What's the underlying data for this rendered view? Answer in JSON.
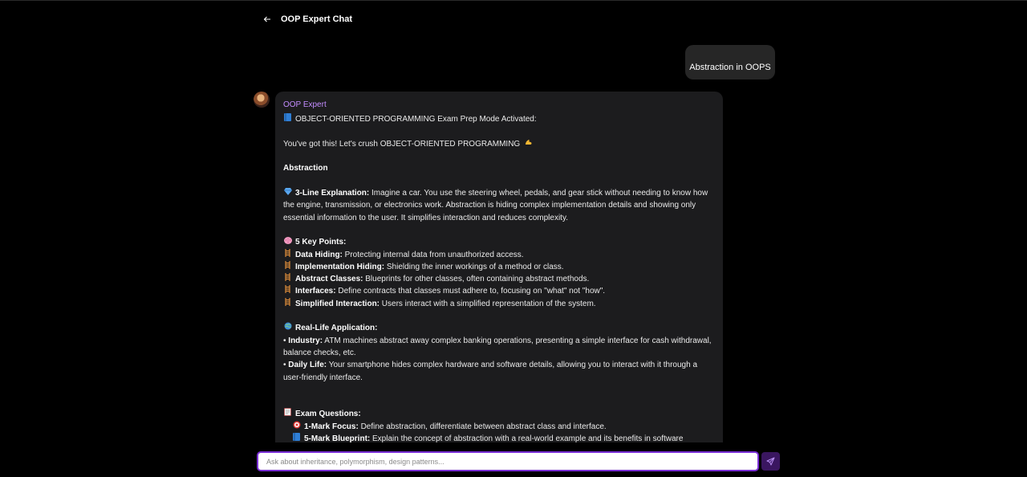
{
  "header": {
    "title": "OOP Expert Chat"
  },
  "user_message": "Abstraction in OOPS",
  "bot": {
    "sender": "OOP Expert",
    "intro": "OBJECT-ORIENTED PROGRAMMING Exam Prep Mode Activated:",
    "encourage": "You've got this! Let's crush OBJECT-ORIENTED PROGRAMMING",
    "heading": "Abstraction",
    "explanation": {
      "label": "3-Line Explanation:",
      "text": " Imagine a car. You use the steering wheel, pedals, and gear stick without needing to know how the engine, transmission, or electronics work. Abstraction is hiding complex implementation details and showing only essential information to the user.  It simplifies interaction and reduces complexity."
    },
    "key_points_label": "5 Key Points:",
    "key_points": [
      {
        "label": "Data Hiding:",
        "text": " Protecting internal data from unauthorized access."
      },
      {
        "label": "Implementation Hiding:",
        "text": "  Shielding the inner workings of a method or class."
      },
      {
        "label": "Abstract Classes:",
        "text": " Blueprints for other classes, often containing abstract methods."
      },
      {
        "label": "Interfaces:",
        "text": " Define contracts that classes must adhere to, focusing on \"what\" not \"how\"."
      },
      {
        "label": "Simplified Interaction:",
        "text": "  Users interact with a simplified representation of the system."
      }
    ],
    "real_life_label": "Real-Life Application:",
    "industry": {
      "label": "Industry:",
      "text": " ATM machines abstract away complex banking operations, presenting a simple interface for cash withdrawal, balance checks, etc."
    },
    "daily": {
      "label": "Daily Life:",
      "text": " Your smartphone hides complex hardware and software details, allowing you to interact with it through a user-friendly interface."
    },
    "exam_label": "Exam Questions:",
    "exam": [
      {
        "label": "1-Mark Focus:",
        "text": " Define abstraction, differentiate between abstract class and interface."
      },
      {
        "label": "5-Mark Blueprint:",
        "text": " Explain the concept of abstraction with a real-world example and its benefits in software"
      }
    ],
    "bullet": "•"
  },
  "input": {
    "placeholder": "Ask about inheritance, polymorphism, design patterns..."
  },
  "icons": {
    "back": "arrow-left-icon",
    "avatar": "avatar",
    "book": "book-icon",
    "flex": "flexed-biceps-icon",
    "gem": "gem-icon",
    "brain": "brain-icon",
    "point": "ladder-icon",
    "globe": "globe-icon",
    "memo": "memo-icon",
    "target": "target-icon",
    "send": "send-icon"
  },
  "colors": {
    "accent": "#7a2fd6",
    "sender": "#c38cff",
    "bubble": "#1c1c1e",
    "user_bubble": "#262626"
  }
}
